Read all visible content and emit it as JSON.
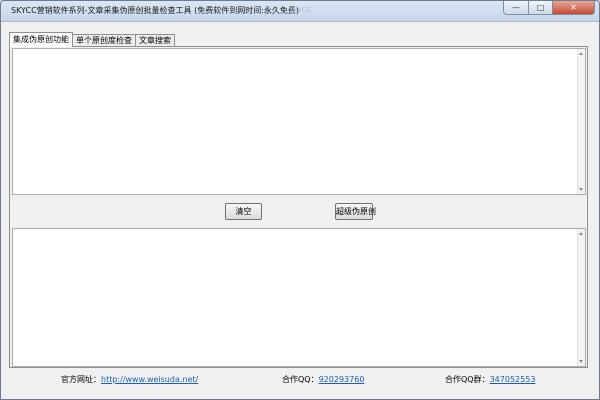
{
  "window": {
    "title": "SKYCC营销软件系列-文章采集伪原创批量检查工具 (免费软件到网时间:永久免费)",
    "ghost_text": "SKYCC"
  },
  "title_buttons": {
    "minimize": "—",
    "maximize": "□",
    "close": "✕"
  },
  "tabs": [
    {
      "label": "集成伪原创功能",
      "active": true
    },
    {
      "label": "单个原创度检查",
      "active": false
    },
    {
      "label": "文章搜索",
      "active": false
    }
  ],
  "buttons": {
    "clear": "清空",
    "pseudo_original": "超级伪原创"
  },
  "inputs": {
    "top_text": "",
    "bottom_text": ""
  },
  "footer": {
    "website_label": "官方网址：",
    "website_link": "http://www.weisuda.net/",
    "qq_label": "合作QQ：",
    "qq_value": "920293760",
    "qq_group_label": "合作QQ群：",
    "qq_group_value": "347052553"
  },
  "icons": {
    "app": "app-icon",
    "scroll_up": "scroll-up-arrow-icon",
    "scroll_down": "scroll-down-arrow-icon"
  }
}
